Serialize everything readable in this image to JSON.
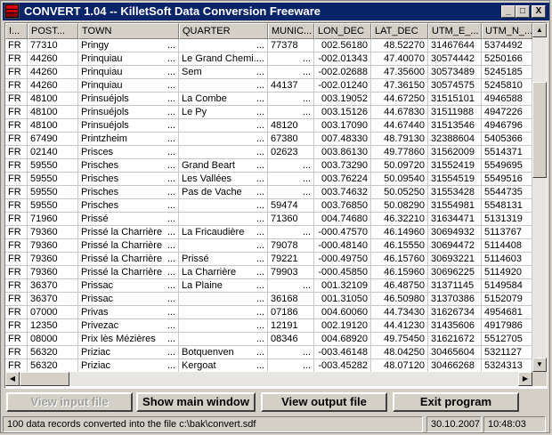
{
  "window": {
    "title": "CONVERT 1.04 -- KilletSoft Data Conversion Freeware",
    "minimize_glyph": "_",
    "maximize_glyph": "□",
    "close_glyph": "X"
  },
  "grid": {
    "columns": [
      "I...",
      "POST...",
      "TOWN",
      "QUARTER",
      "MUNIC...",
      "LON_DEC",
      "LAT_DEC",
      "UTM_E_...",
      "UTM_N_..."
    ],
    "rows": [
      [
        "FR",
        "77310",
        "Pringy",
        "",
        "77378",
        "002.56180",
        "48.52270",
        "31467644",
        "5374492"
      ],
      [
        "FR",
        "44260",
        "Prinquiau",
        "Le Grand Chemi...",
        "",
        "-002.01343",
        "47.40070",
        "30574442",
        "5250166"
      ],
      [
        "FR",
        "44260",
        "Prinquiau",
        "Sem",
        "",
        "-002.02688",
        "47.35600",
        "30573489",
        "5245185"
      ],
      [
        "FR",
        "44260",
        "Prinquiau",
        "",
        "44137",
        "-002.01240",
        "47.36150",
        "30574575",
        "5245810"
      ],
      [
        "FR",
        "48100",
        "Prinsuéjols",
        "La Combe",
        "",
        "003.19052",
        "44.67250",
        "31515101",
        "4946588"
      ],
      [
        "FR",
        "48100",
        "Prinsuéjols",
        "Le Py",
        "",
        "003.15126",
        "44.67830",
        "31511988",
        "4947226"
      ],
      [
        "FR",
        "48100",
        "Prinsuéjols",
        "",
        "48120",
        "003.17090",
        "44.67440",
        "31513546",
        "4946796"
      ],
      [
        "FR",
        "67490",
        "Printzheim",
        "",
        "67380",
        "007.48330",
        "48.79130",
        "32388604",
        "5405366"
      ],
      [
        "FR",
        "02140",
        "Prisces",
        "",
        "02623",
        "003.86130",
        "49.77860",
        "31562009",
        "5514371"
      ],
      [
        "FR",
        "59550",
        "Prisches",
        "Grand Beart",
        "",
        "003.73290",
        "50.09720",
        "31552419",
        "5549695"
      ],
      [
        "FR",
        "59550",
        "Prisches",
        "Les Vallées",
        "",
        "003.76224",
        "50.09540",
        "31554519",
        "5549516"
      ],
      [
        "FR",
        "59550",
        "Prisches",
        "Pas de Vache",
        "",
        "003.74632",
        "50.05250",
        "31553428",
        "5544735"
      ],
      [
        "FR",
        "59550",
        "Prisches",
        "",
        "59474",
        "003.76850",
        "50.08290",
        "31554981",
        "5548131"
      ],
      [
        "FR",
        "71960",
        "Prissé",
        "",
        "71360",
        "004.74680",
        "46.32210",
        "31634471",
        "5131319"
      ],
      [
        "FR",
        "79360",
        "Prissé la Charrière",
        "La Fricaudière",
        "",
        "-000.47570",
        "46.14960",
        "30694932",
        "5113767"
      ],
      [
        "FR",
        "79360",
        "Prissé la Charrière",
        "",
        "79078",
        "-000.48140",
        "46.15550",
        "30694472",
        "5114408"
      ],
      [
        "FR",
        "79360",
        "Prissé la Charrière",
        "Prissé",
        "79221",
        "-000.49750",
        "46.15760",
        "30693221",
        "5114603"
      ],
      [
        "FR",
        "79360",
        "Prissé la Charrière",
        "La Charrière",
        "79903",
        "-000.45850",
        "46.15960",
        "30696225",
        "5114920"
      ],
      [
        "FR",
        "36370",
        "Prissac",
        "La Plaine",
        "",
        "001.32109",
        "46.48750",
        "31371145",
        "5149584"
      ],
      [
        "FR",
        "36370",
        "Prissac",
        "",
        "36168",
        "001.31050",
        "46.50980",
        "31370386",
        "5152079"
      ],
      [
        "FR",
        "07000",
        "Privas",
        "",
        "07186",
        "004.60060",
        "44.73430",
        "31626734",
        "4954681"
      ],
      [
        "FR",
        "12350",
        "Privezac",
        "",
        "12191",
        "002.19120",
        "44.41230",
        "31435606",
        "4917986"
      ],
      [
        "FR",
        "08000",
        "Prix lès Mézières",
        "",
        "08346",
        "004.68920",
        "49.75450",
        "31621672",
        "5512705"
      ],
      [
        "FR",
        "56320",
        "Priziac",
        "Botquenven",
        "",
        "-003.46148",
        "48.04250",
        "30465604",
        "5321127"
      ],
      [
        "FR",
        "56320",
        "Priziac",
        "Kergoat",
        "",
        "-003.45282",
        "48.07120",
        "30466268",
        "5324313"
      ]
    ]
  },
  "buttons": {
    "view_input": "View input file",
    "show_main": "Show main window",
    "view_output": "View output file",
    "exit": "Exit program"
  },
  "status": {
    "message": "100 data records converted into the file c:\\bak\\convert.sdf",
    "date": "30.10.2007",
    "time": "10:48:03"
  },
  "scrollbar_glyphs": {
    "up": "▲",
    "down": "▼",
    "left": "◀",
    "right": "▶"
  },
  "ellipsis": "..."
}
